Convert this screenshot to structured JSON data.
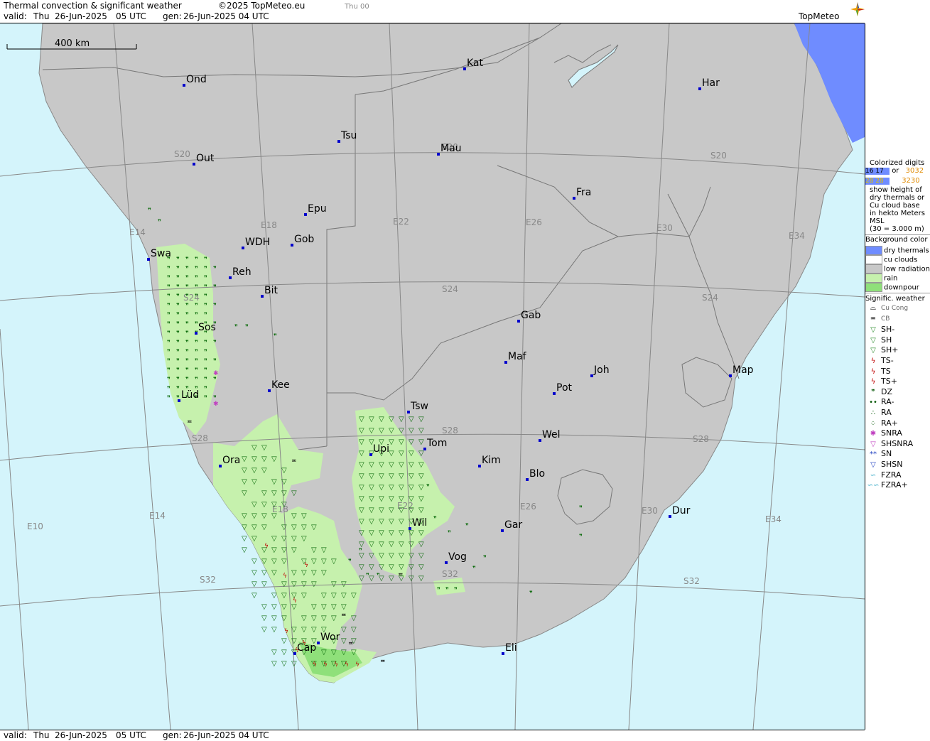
{
  "header": {
    "title": "Thermal convection & significant weather",
    "copyright": "©2025 TopMeteo.eu",
    "tab": "Thu 00",
    "valid_label": "valid:",
    "valid_day": "Thu",
    "valid_date": "26-Jun-2025",
    "valid_time": "05 UTC",
    "gen_label": "gen:",
    "gen_value": "26-Jun-2025 04 UTC",
    "logo": "TopMeteo"
  },
  "scale_bar": {
    "label": "400 km"
  },
  "cities": [
    {
      "name": "Ond"
    },
    {
      "name": "Kat"
    },
    {
      "name": "Har"
    },
    {
      "name": "Tsu"
    },
    {
      "name": "Mau"
    },
    {
      "name": "Out"
    },
    {
      "name": "Fra"
    },
    {
      "name": "Epu"
    },
    {
      "name": "WDH"
    },
    {
      "name": "Gob"
    },
    {
      "name": "Swa"
    },
    {
      "name": "Reh"
    },
    {
      "name": "Bit"
    },
    {
      "name": "Gab"
    },
    {
      "name": "Sos"
    },
    {
      "name": "Maf"
    },
    {
      "name": "Joh"
    },
    {
      "name": "Map"
    },
    {
      "name": "Kee"
    },
    {
      "name": "Pot"
    },
    {
      "name": "Lüd"
    },
    {
      "name": "Tsw"
    },
    {
      "name": "Wel"
    },
    {
      "name": "Tom"
    },
    {
      "name": "Upi"
    },
    {
      "name": "Kim"
    },
    {
      "name": "Ora"
    },
    {
      "name": "Blo"
    },
    {
      "name": "Dur"
    },
    {
      "name": "Wil"
    },
    {
      "name": "Gar"
    },
    {
      "name": "Vog"
    },
    {
      "name": "Wor"
    },
    {
      "name": "Cap"
    },
    {
      "name": "Eli"
    }
  ],
  "grid_labels": [
    "S20",
    "S20",
    "S20",
    "E14",
    "E18",
    "E22",
    "E26",
    "E30",
    "E34",
    "S24",
    "S24",
    "S24",
    "S28",
    "S28",
    "S28",
    "E14",
    "E10",
    "E18",
    "E22",
    "E26",
    "E30",
    "E34",
    "S32",
    "S32",
    "S32"
  ],
  "legend": {
    "colorized_title": "Colorized digits",
    "digits_a": "16 17",
    "digits_b": "28 28",
    "digits_or": "or",
    "digits_c": "3032",
    "digits_d": "3230",
    "desc_1": "show height of",
    "desc_2": "dry thermals or",
    "desc_3": "Cu cloud base",
    "desc_4": "in hekto Meters",
    "desc_5": "MSL",
    "desc_6": "(30 = 3.000 m)",
    "bg_title": "Background color",
    "bg_items": [
      {
        "label": "dry thermals",
        "color": "#6f8cff"
      },
      {
        "label": "cu clouds",
        "color": "#ffffff"
      },
      {
        "label": "low radiation",
        "color": "#c8c8c8"
      },
      {
        "label": "rain",
        "color": "#c6f1ad"
      },
      {
        "label": "downpour",
        "color": "#8fe07a"
      }
    ],
    "wx_title": "Signific. weather",
    "wx_items": [
      {
        "label": "Cu Cong",
        "symbol": "⌓",
        "color": "#000000"
      },
      {
        "label": "CB",
        "symbol": "≖",
        "color": "#000000"
      },
      {
        "label": "SH-",
        "symbol": "▽",
        "color": "#2a8a2a"
      },
      {
        "label": "SH",
        "symbol": "▽",
        "color": "#2a8a2a"
      },
      {
        "label": "SH+",
        "symbol": "▽",
        "color": "#2a8a2a"
      },
      {
        "label": "TS-",
        "symbol": "ϟ",
        "color": "#c00000"
      },
      {
        "label": "TS",
        "symbol": "ϟ",
        "color": "#c00000"
      },
      {
        "label": "TS+",
        "symbol": "ϟ",
        "color": "#c00000"
      },
      {
        "label": "DZ",
        "symbol": "❞",
        "color": "#0a5a0a"
      },
      {
        "label": "RA-",
        "symbol": "••",
        "color": "#0a5a0a"
      },
      {
        "label": "RA",
        "symbol": "∴",
        "color": "#0a5a0a"
      },
      {
        "label": "RA+",
        "symbol": "⁘",
        "color": "#0a5a0a"
      },
      {
        "label": "SNRA",
        "symbol": "✱",
        "color": "#c040c0"
      },
      {
        "label": "SHSNRA",
        "symbol": "▽",
        "color": "#c040c0"
      },
      {
        "label": "SN",
        "symbol": "**",
        "color": "#2040c0"
      },
      {
        "label": "SHSN",
        "symbol": "▽",
        "color": "#2040c0"
      },
      {
        "label": "FZRA",
        "symbol": "∽",
        "color": "#20a0c0"
      },
      {
        "label": "FZRA+",
        "symbol": "∽∽",
        "color": "#20a0c0"
      }
    ]
  },
  "colors": {
    "sea": "#d4f4fb",
    "land": "#c8c8c8",
    "rain": "#c6f1ad",
    "downpour": "#8fe07a",
    "dry_thermals": "#6f8cff",
    "city_marker": "#0000cc",
    "grid": "#888888"
  }
}
